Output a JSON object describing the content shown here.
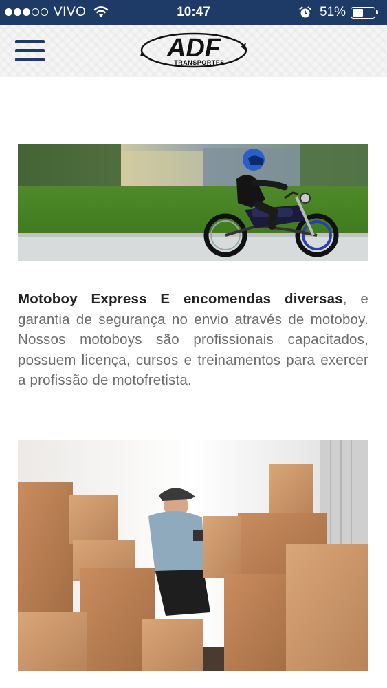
{
  "status_bar": {
    "carrier": "VIVO",
    "time": "10:47",
    "battery_percent": "51%",
    "battery_level": 0.51,
    "signal_bars_filled": 3,
    "signal_bars_total": 5
  },
  "header": {
    "logo_text": "ADF",
    "logo_subtext": "TRANSPORTES",
    "brand_color": "#1e3a66"
  },
  "content": {
    "service_title": "Motoboy Express E encomendas diversas",
    "service_description": ", e garantia de segurança no envio através de motoboy. Nossos motoboys são profissionais capacitados, possuem licença, cursos e treinamentos para exercer a profissão de motofretista."
  }
}
